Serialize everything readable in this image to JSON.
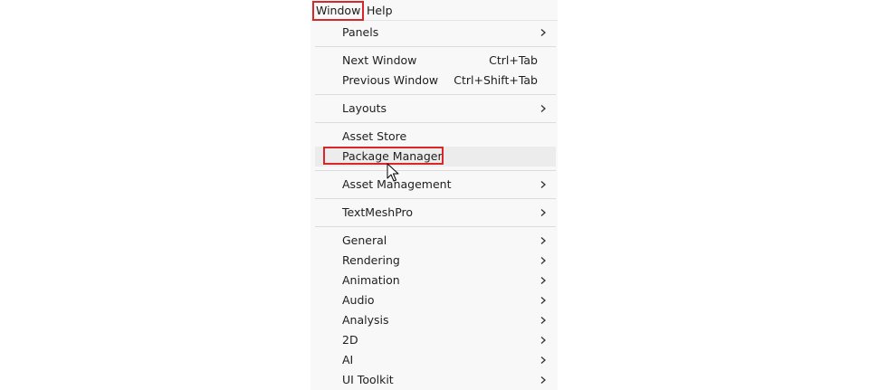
{
  "menubar": {
    "window_label": "Window",
    "help_label": "Help"
  },
  "menu": {
    "panels": "Panels",
    "next_window": "Next Window",
    "next_window_shortcut": "Ctrl+Tab",
    "previous_window": "Previous Window",
    "previous_window_shortcut": "Ctrl+Shift+Tab",
    "layouts": "Layouts",
    "asset_store": "Asset Store",
    "package_manager": "Package Manager",
    "asset_management": "Asset Management",
    "textmeshpro": "TextMeshPro",
    "general": "General",
    "rendering": "Rendering",
    "animation": "Animation",
    "audio": "Audio",
    "analysis": "Analysis",
    "two_d": "2D",
    "ai": "AI",
    "ui_toolkit": "UI Toolkit"
  },
  "icons": {
    "submenu": "chevron-right-icon",
    "pointer": "mouse-cursor-icon"
  },
  "colors": {
    "highlight_border": "#d9262b",
    "menu_background": "#f8f8f8",
    "hover_background": "#ececec"
  }
}
